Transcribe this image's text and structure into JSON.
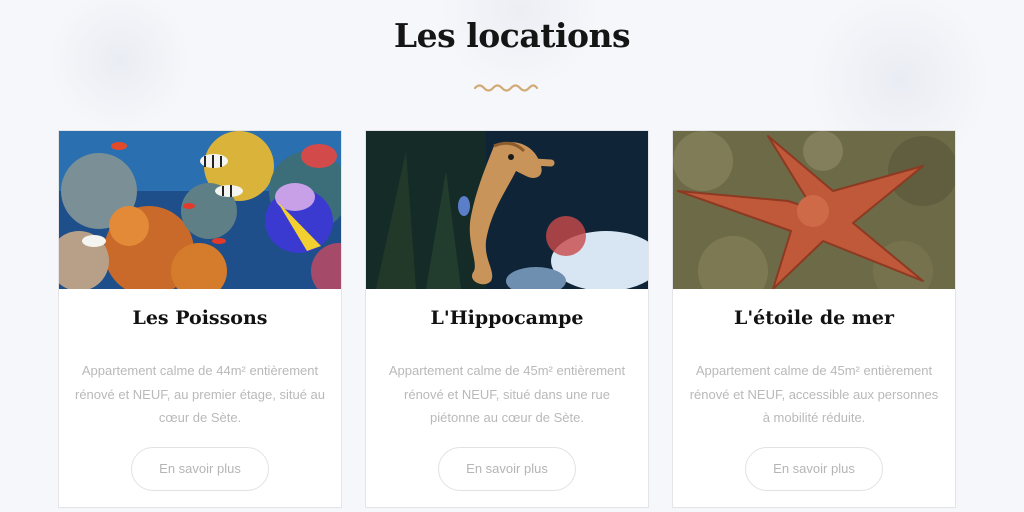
{
  "section": {
    "title": "Les locations"
  },
  "colors": {
    "accent": "#d2aa76",
    "title": "#151515",
    "text_muted": "#b9b9b9"
  },
  "cards": [
    {
      "image": "coral-reef-fish-photo",
      "name": "Les Poissons",
      "description": "Appartement calme de 44m² entièrement rénové et NEUF, au premier étage, situé au cœur de Sète.",
      "button": "En savoir plus"
    },
    {
      "image": "seahorse-photo",
      "name": "L'Hippocampe",
      "description": "Appartement calme de 45m² entièrement rénové et NEUF, situé dans une rue piétonne au cœur de Sète.",
      "button": "En savoir plus"
    },
    {
      "image": "starfish-photo",
      "name": "L'étoile de mer",
      "description": "Appartement calme de 45m² entièrement rénové et NEUF, accessible aux personnes à mobilité réduite.",
      "button": "En savoir plus"
    }
  ]
}
